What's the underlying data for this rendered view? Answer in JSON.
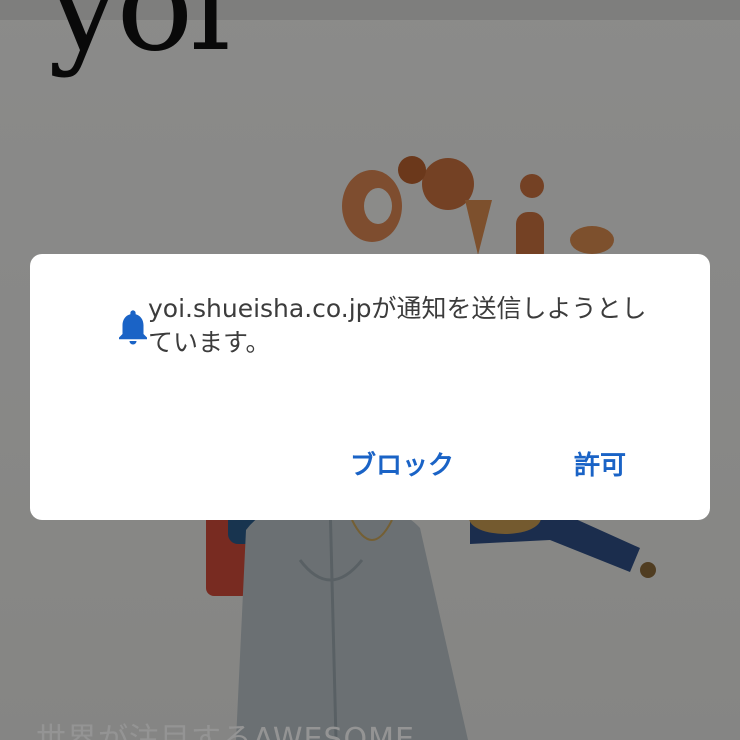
{
  "background_page": {
    "logo_text": "yoi",
    "headline": "世界が注目するAWESOME"
  },
  "notification_dialog": {
    "icon": "bell-icon",
    "message": "yoi.shueisha.co.jpが通知を送信しようとしています。",
    "block_label": "ブロック",
    "allow_label": "許可"
  },
  "colors": {
    "accent": "#1a63c6",
    "dialog_background": "#ffffff",
    "scrim": "rgba(0,0,0,0.42)",
    "message_text": "#3c3c3c"
  }
}
